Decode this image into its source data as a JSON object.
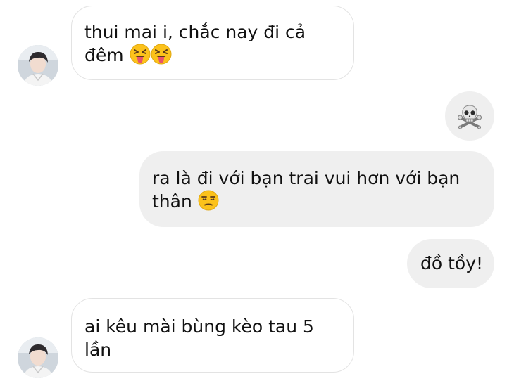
{
  "chat": {
    "messages": [
      {
        "direction": "incoming",
        "line1": "thui mai i, chắc nay đi cả",
        "line2": "đêm",
        "emojis": [
          "squinting-tongue-face-emoji",
          "squinting-tongue-face-emoji"
        ]
      },
      {
        "direction": "outgoing",
        "emojis": [
          "skull-and-crossbones-emoji"
        ]
      },
      {
        "direction": "outgoing",
        "line1": "ra là đi với bạn trai vui hơn với bạn",
        "line2": "thân",
        "emojis": [
          "unamused-face-emoji"
        ]
      },
      {
        "direction": "outgoing",
        "line1": "đồ tồy!"
      },
      {
        "direction": "incoming",
        "line1": "ai kêu mài bùng kèo tau 5",
        "line2": "lần"
      }
    ]
  },
  "colors": {
    "outgoing_bubble": "#efefef",
    "incoming_bubble": "#ffffff",
    "incoming_border": "#e3e3e3",
    "text": "#111111"
  }
}
